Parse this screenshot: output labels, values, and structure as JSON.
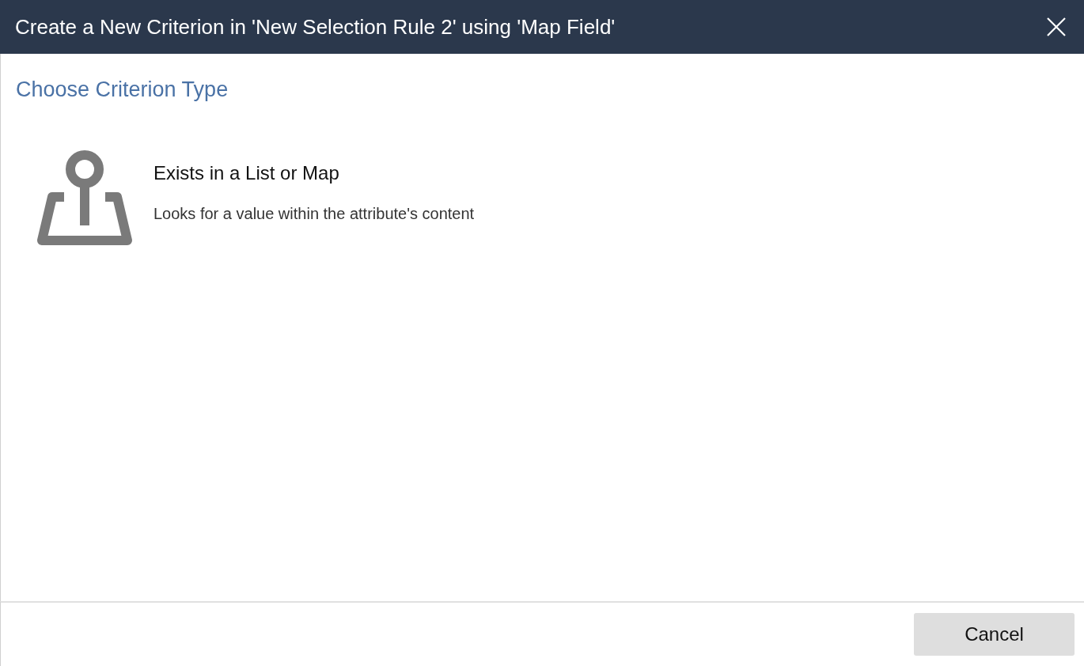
{
  "dialog": {
    "title": "Create a New Criterion in 'New Selection Rule 2' using 'Map Field'"
  },
  "section": {
    "heading": "Choose Criterion Type"
  },
  "criterion_types": [
    {
      "kind": "map",
      "title": "Exists in a List or Map",
      "description": "Looks for a value within the attribute's content"
    }
  ],
  "buttons": [
    "Cancel"
  ]
}
